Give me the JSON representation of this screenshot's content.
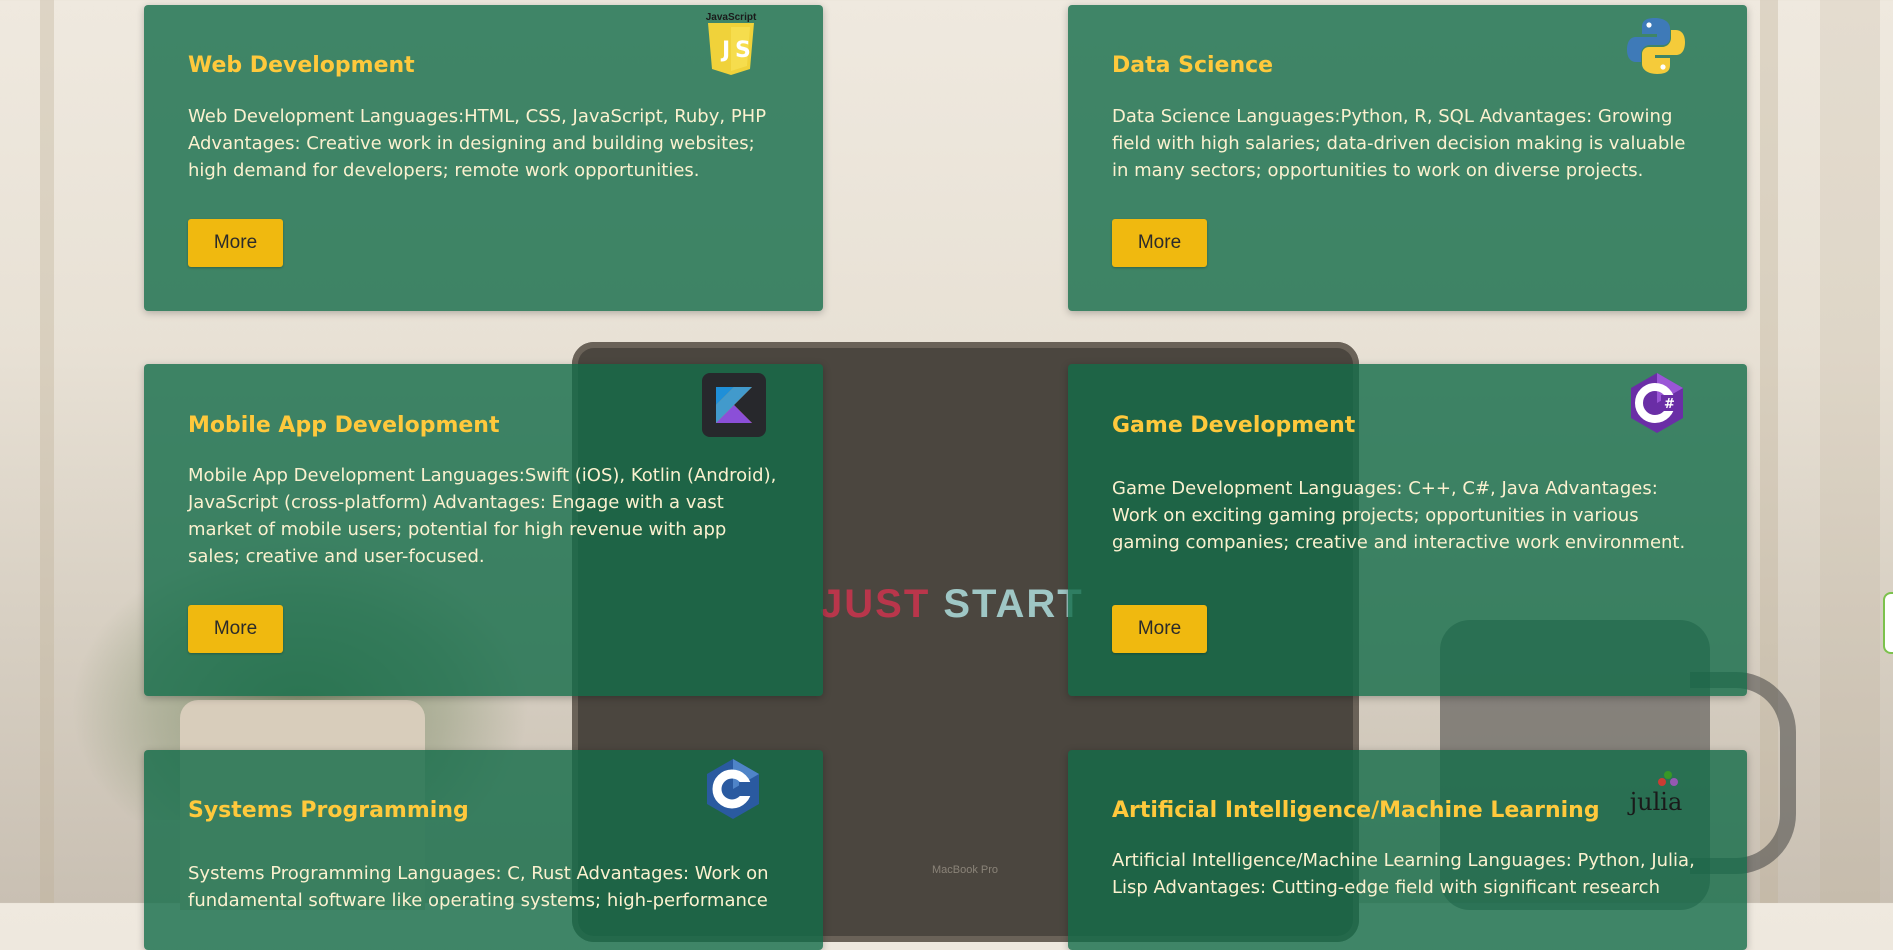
{
  "background": {
    "title_word1": "JUST",
    "title_word2": "START",
    "laptop_label": "MacBook Pro"
  },
  "cards": [
    {
      "title": "Web Development",
      "description": "Web Development Languages:HTML, CSS, JavaScript, Ruby, PHP Advantages: Creative work in designing and building websites; high demand for developers; remote work opportunities.",
      "button": "More",
      "icon": "javascript-icon",
      "icon_caption": "JavaScript"
    },
    {
      "title": "Data Science",
      "description": "Data Science Languages:Python, R, SQL Advantages: Growing field with high salaries; data-driven decision making is valuable in many sectors; opportunities to work on diverse projects.",
      "button": "More",
      "icon": "python-icon"
    },
    {
      "title": "Mobile App Development",
      "description": "Mobile App Development Languages:Swift (iOS), Kotlin (Android), JavaScript (cross-platform) Advantages: Engage with a vast market of mobile users; potential for high revenue with app sales; creative and user-focused.",
      "button": "More",
      "icon": "kotlin-icon"
    },
    {
      "title": "Game Development",
      "description": "Game Development Languages: C++, C#, Java Advantages: Work on exciting gaming projects; opportunities in various gaming companies; creative and interactive work environment.",
      "button": "More",
      "icon": "csharp-icon",
      "icon_caption": "#"
    },
    {
      "title": "Systems Programming",
      "description": "Systems Programming Languages: C, Rust Advantages: Work on fundamental software like operating systems; high-performance",
      "icon": "c-language-icon"
    },
    {
      "title": "Artificial Intelligence/Machine Learning",
      "description": "Artificial Intelligence/Machine Learning Languages: Python, Julia, Lisp Advantages: Cutting-edge field with significant research",
      "icon": "julia-icon",
      "icon_caption": "julia"
    }
  ],
  "colors": {
    "card_bg": "#136b49",
    "title": "#ffc93c",
    "button": "#f0b90f"
  }
}
